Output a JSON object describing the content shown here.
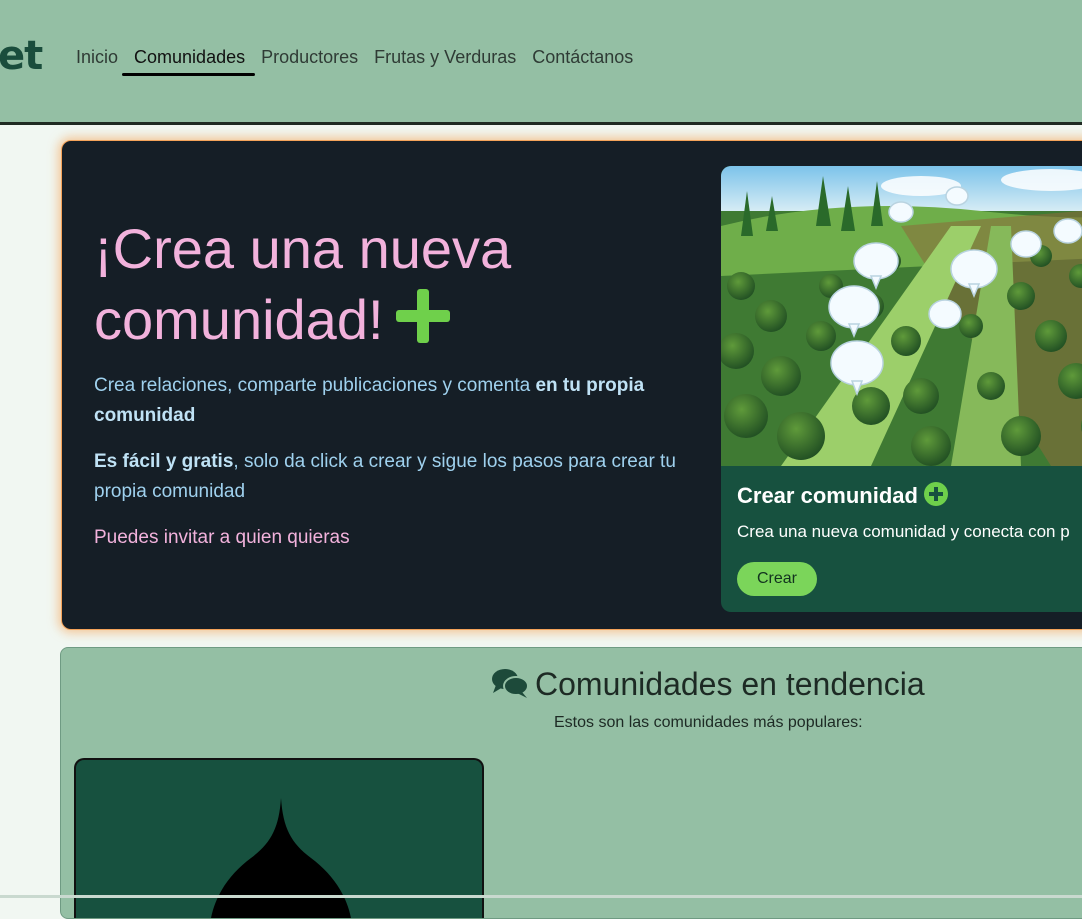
{
  "header": {
    "logo_text": "et",
    "nav": [
      {
        "label": "Inicio",
        "active": false
      },
      {
        "label": "Comunidades",
        "active": true
      },
      {
        "label": "Productores",
        "active": false
      },
      {
        "label": "Frutas y Verduras",
        "active": false
      },
      {
        "label": "Contáctanos",
        "active": false
      }
    ]
  },
  "hero": {
    "title": "¡Crea una nueva comunidad!",
    "p1_text": "Crea relaciones, comparte publicaciones y comenta ",
    "p1_bold": "en tu propia comunidad",
    "p2_bold": "Es fácil y gratis",
    "p2_text": ", solo da click a crear y sigue los pasos para crear tu propia comunidad",
    "p3_text": "Puedes invitar a quien quieras"
  },
  "create_card": {
    "title": "Crear comunidad",
    "text": "Crea una nueva comunidad y conecta con p",
    "button_label": "Crear"
  },
  "trending": {
    "title": "Comunidades en tendencia",
    "subtitle": "Estos son las comunidades más populares:"
  },
  "colors": {
    "header_bg": "#94bfa4",
    "hero_bg": "#151e26",
    "hero_title": "#f2b2dc",
    "accent_green": "#6fd04b",
    "card_bg": "#17513f"
  },
  "icons": [
    "plus-icon",
    "plus-circle-icon",
    "comments-icon"
  ]
}
